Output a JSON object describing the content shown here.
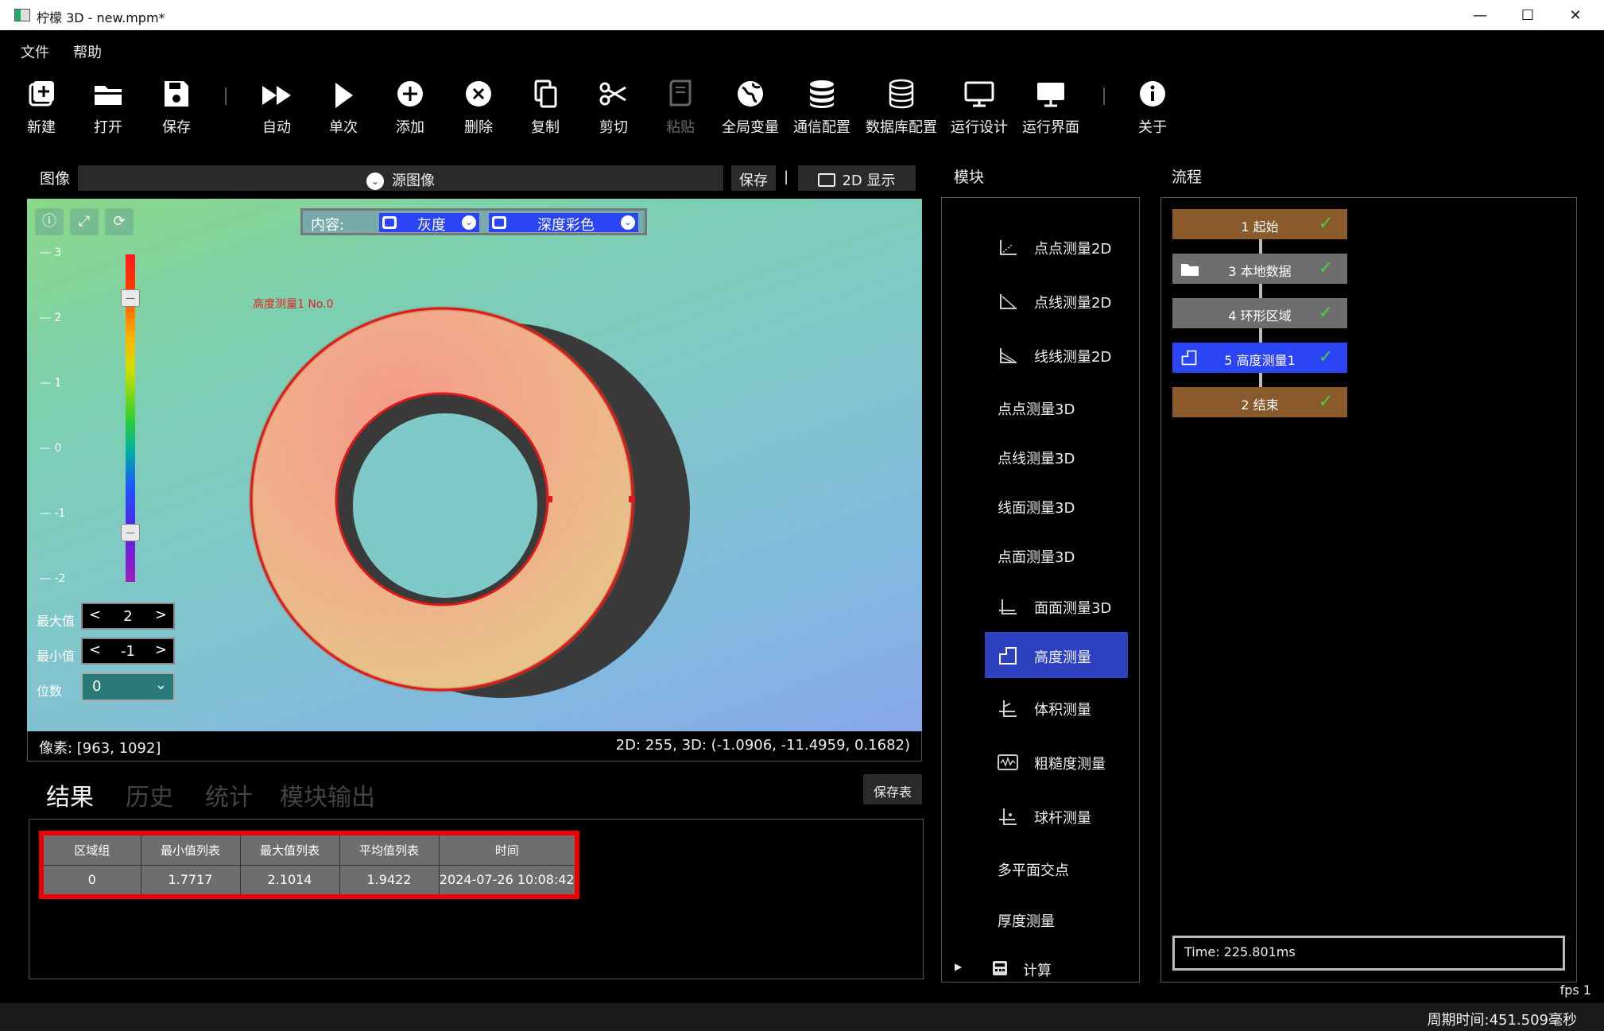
{
  "window": {
    "title": "柠檬 3D  - new.mpm*",
    "minimize": "—",
    "maximize": "☐",
    "close": "✕"
  },
  "menu": {
    "file": "文件",
    "help": "帮助"
  },
  "toolbar": {
    "new": "新建",
    "open": "打开",
    "save": "保存",
    "auto": "自动",
    "single": "单次",
    "add": "添加",
    "delete": "删除",
    "copy": "复制",
    "cut": "剪切",
    "paste": "粘贴",
    "global_vars": "全局变量",
    "comm_config": "通信配置",
    "db_config": "数据库配置",
    "run_design": "运行设计",
    "run_ui": "运行界面",
    "about": "关于"
  },
  "image_panel": {
    "label": "图像",
    "source_select": "源图像",
    "save_button": "保存",
    "divider": "|",
    "display_mode": "2D 显示",
    "content_label": "内容:",
    "content_gray": "灰度",
    "content_depth": "深度彩色",
    "scale_ticks": [
      "3",
      "2",
      "1",
      "0",
      "-1",
      "-2"
    ],
    "max_label": "最大值",
    "max_value": "2",
    "min_label": "最小值",
    "min_value": "-1",
    "digits_label": "位数",
    "digits_value": "0",
    "measure_overlay": "高度测量1 No.0",
    "pixel_readout": "像素: [963, 1092]",
    "value_readout": "2D: 255, 3D: (-1.0906, -11.4959, 0.1682)"
  },
  "result_tabs": {
    "result": "结果",
    "history": "历史",
    "stats": "统计",
    "module_output": "模块输出",
    "save_table": "保存表"
  },
  "result_table": {
    "headers": [
      "区域组",
      "最小值列表",
      "最大值列表",
      "平均值列表",
      "时间"
    ],
    "rows": [
      [
        "0",
        "1.7717",
        "2.1014",
        "1.9422",
        "2024-07-26 10:08:42"
      ]
    ]
  },
  "modules": {
    "label": "模块",
    "items": [
      "点点测量2D",
      "点线测量2D",
      "线线测量2D",
      "点点测量3D",
      "点线测量3D",
      "线面测量3D",
      "点面测量3D",
      "面面测量3D",
      "高度测量",
      "体积测量",
      "粗糙度测量",
      "球杆测量",
      "多平面交点",
      "厚度测量",
      "计算"
    ]
  },
  "flow": {
    "label": "流程",
    "nodes": [
      "1 起始",
      "3 本地数据",
      "4 环形区域",
      "5 高度测量1",
      "2 结束"
    ],
    "time": "Time: 225.801ms"
  },
  "status": {
    "fps": "fps 1",
    "cycle": "周期时间:451.509毫秒"
  },
  "colors": {
    "accent_blue": "#2b44f5",
    "selected_module": "#2d40c0",
    "flow_brown": "#8a5a2b",
    "flow_gray": "#6e6e6e",
    "highlight_red": "#ee0000"
  }
}
